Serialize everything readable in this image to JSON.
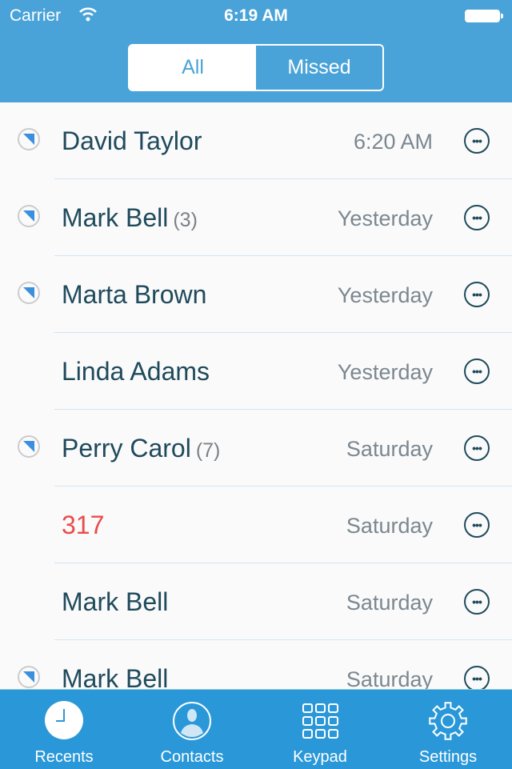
{
  "status_bar": {
    "carrier": "Carrier",
    "time": "6:19 AM",
    "wifi_icon": "wifi-icon",
    "battery_icon": "battery-icon"
  },
  "segment": {
    "all": "All",
    "missed": "Missed",
    "selected": "All"
  },
  "calls": [
    {
      "name": "David Taylor",
      "count": "",
      "time": "6:20 AM",
      "unread": true,
      "missed": false
    },
    {
      "name": "Mark Bell",
      "count": "(3)",
      "time": "Yesterday",
      "unread": true,
      "missed": false
    },
    {
      "name": "Marta Brown",
      "count": "",
      "time": "Yesterday",
      "unread": true,
      "missed": false
    },
    {
      "name": "Linda Adams",
      "count": "",
      "time": "Yesterday",
      "unread": false,
      "missed": false
    },
    {
      "name": "Perry Carol",
      "count": "(7)",
      "time": "Saturday",
      "unread": true,
      "missed": false
    },
    {
      "name": "317",
      "count": "",
      "time": "Saturday",
      "unread": false,
      "missed": true
    },
    {
      "name": "Mark Bell",
      "count": "",
      "time": "Saturday",
      "unread": false,
      "missed": false
    },
    {
      "name": "Mark Bell",
      "count": "",
      "time": "Saturday",
      "unread": true,
      "missed": false
    }
  ],
  "tabs": [
    {
      "label": "Recents",
      "icon": "clock-icon",
      "active": true
    },
    {
      "label": "Contacts",
      "icon": "contact-icon",
      "active": false
    },
    {
      "label": "Keypad",
      "icon": "keypad-icon",
      "active": false
    },
    {
      "label": "Settings",
      "icon": "gear-icon",
      "active": false
    }
  ],
  "colors": {
    "header": "#4aa3d8",
    "tabbar": "#2a98d8",
    "name": "#1f4a5c",
    "missed": "#e94c4c",
    "unread": "#3a8fdf"
  }
}
